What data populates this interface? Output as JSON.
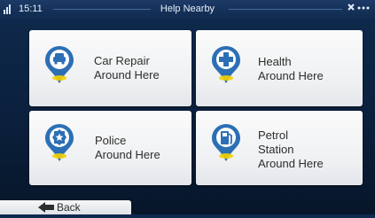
{
  "status_bar": {
    "time": "15:11",
    "title": "Help Nearby",
    "gps_icon": "satellite-icon"
  },
  "tiles": [
    {
      "label_line1": "Car Repair",
      "label_line2": "Around Here",
      "icon": "car-repair-icon"
    },
    {
      "label_line1": "Health",
      "label_line2": "Around Here",
      "icon": "health-icon"
    },
    {
      "label_line1": "Police",
      "label_line2": "Around Here",
      "icon": "police-icon"
    },
    {
      "label_line1": "Petrol",
      "label_line2": "Station",
      "label_line3": "Around Here",
      "icon": "petrol-station-icon"
    }
  ],
  "footer": {
    "back_label": "Back"
  },
  "colors": {
    "icon_blue": "#2c6fb5",
    "pin_yellow": "#f3d000",
    "background": "#0f2a4e"
  }
}
